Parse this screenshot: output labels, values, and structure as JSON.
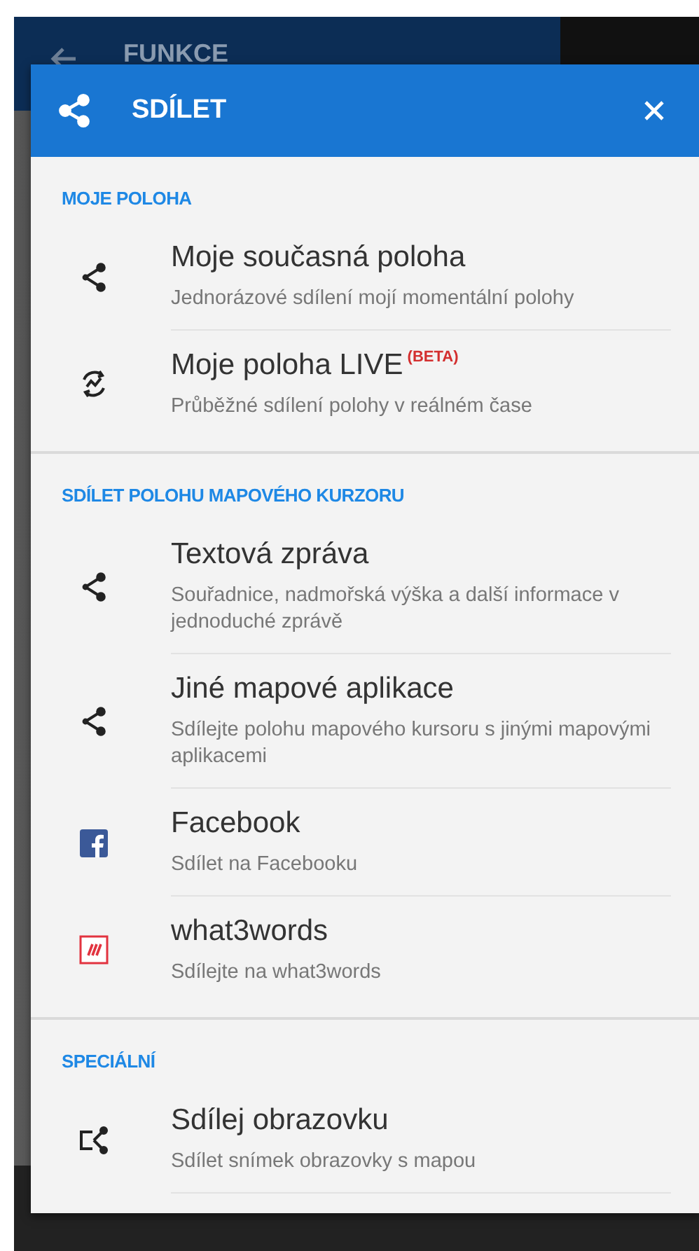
{
  "background_app": {
    "title": "FUNKCE"
  },
  "dialog": {
    "title": "SDÍLET",
    "sections": [
      {
        "header": "MOJE POLOHA",
        "items": [
          {
            "kind": "share",
            "title": "Moje současná poloha",
            "subtitle": "Jednorázové sdílení mojí momentální polohy"
          },
          {
            "kind": "live",
            "title": "Moje poloha LIVE",
            "badge": "(BETA)",
            "subtitle": "Průběžné sdílení polohy v reálném čase"
          }
        ]
      },
      {
        "header": "SDÍLET POLOHU MAPOVÉHO KURZORU",
        "items": [
          {
            "kind": "share",
            "title": "Textová zpráva",
            "subtitle": "Souřadnice, nadmořská výška a další informace v jednoduché zprávě"
          },
          {
            "kind": "share",
            "title": "Jiné mapové aplikace",
            "subtitle": "Sdílejte polohu mapového kursoru s jinými mapovými aplikacemi"
          },
          {
            "kind": "facebook",
            "title": "Facebook",
            "subtitle": "Sdílet na Facebooku"
          },
          {
            "kind": "what3words",
            "title": "what3words",
            "subtitle": "Sdílejte na what3words"
          }
        ]
      },
      {
        "header": "SPECIÁLNÍ",
        "items": [
          {
            "kind": "screen",
            "title": "Sdílej obrazovku",
            "subtitle": "Sdílet snímek obrazovky s mapou"
          }
        ]
      }
    ]
  }
}
